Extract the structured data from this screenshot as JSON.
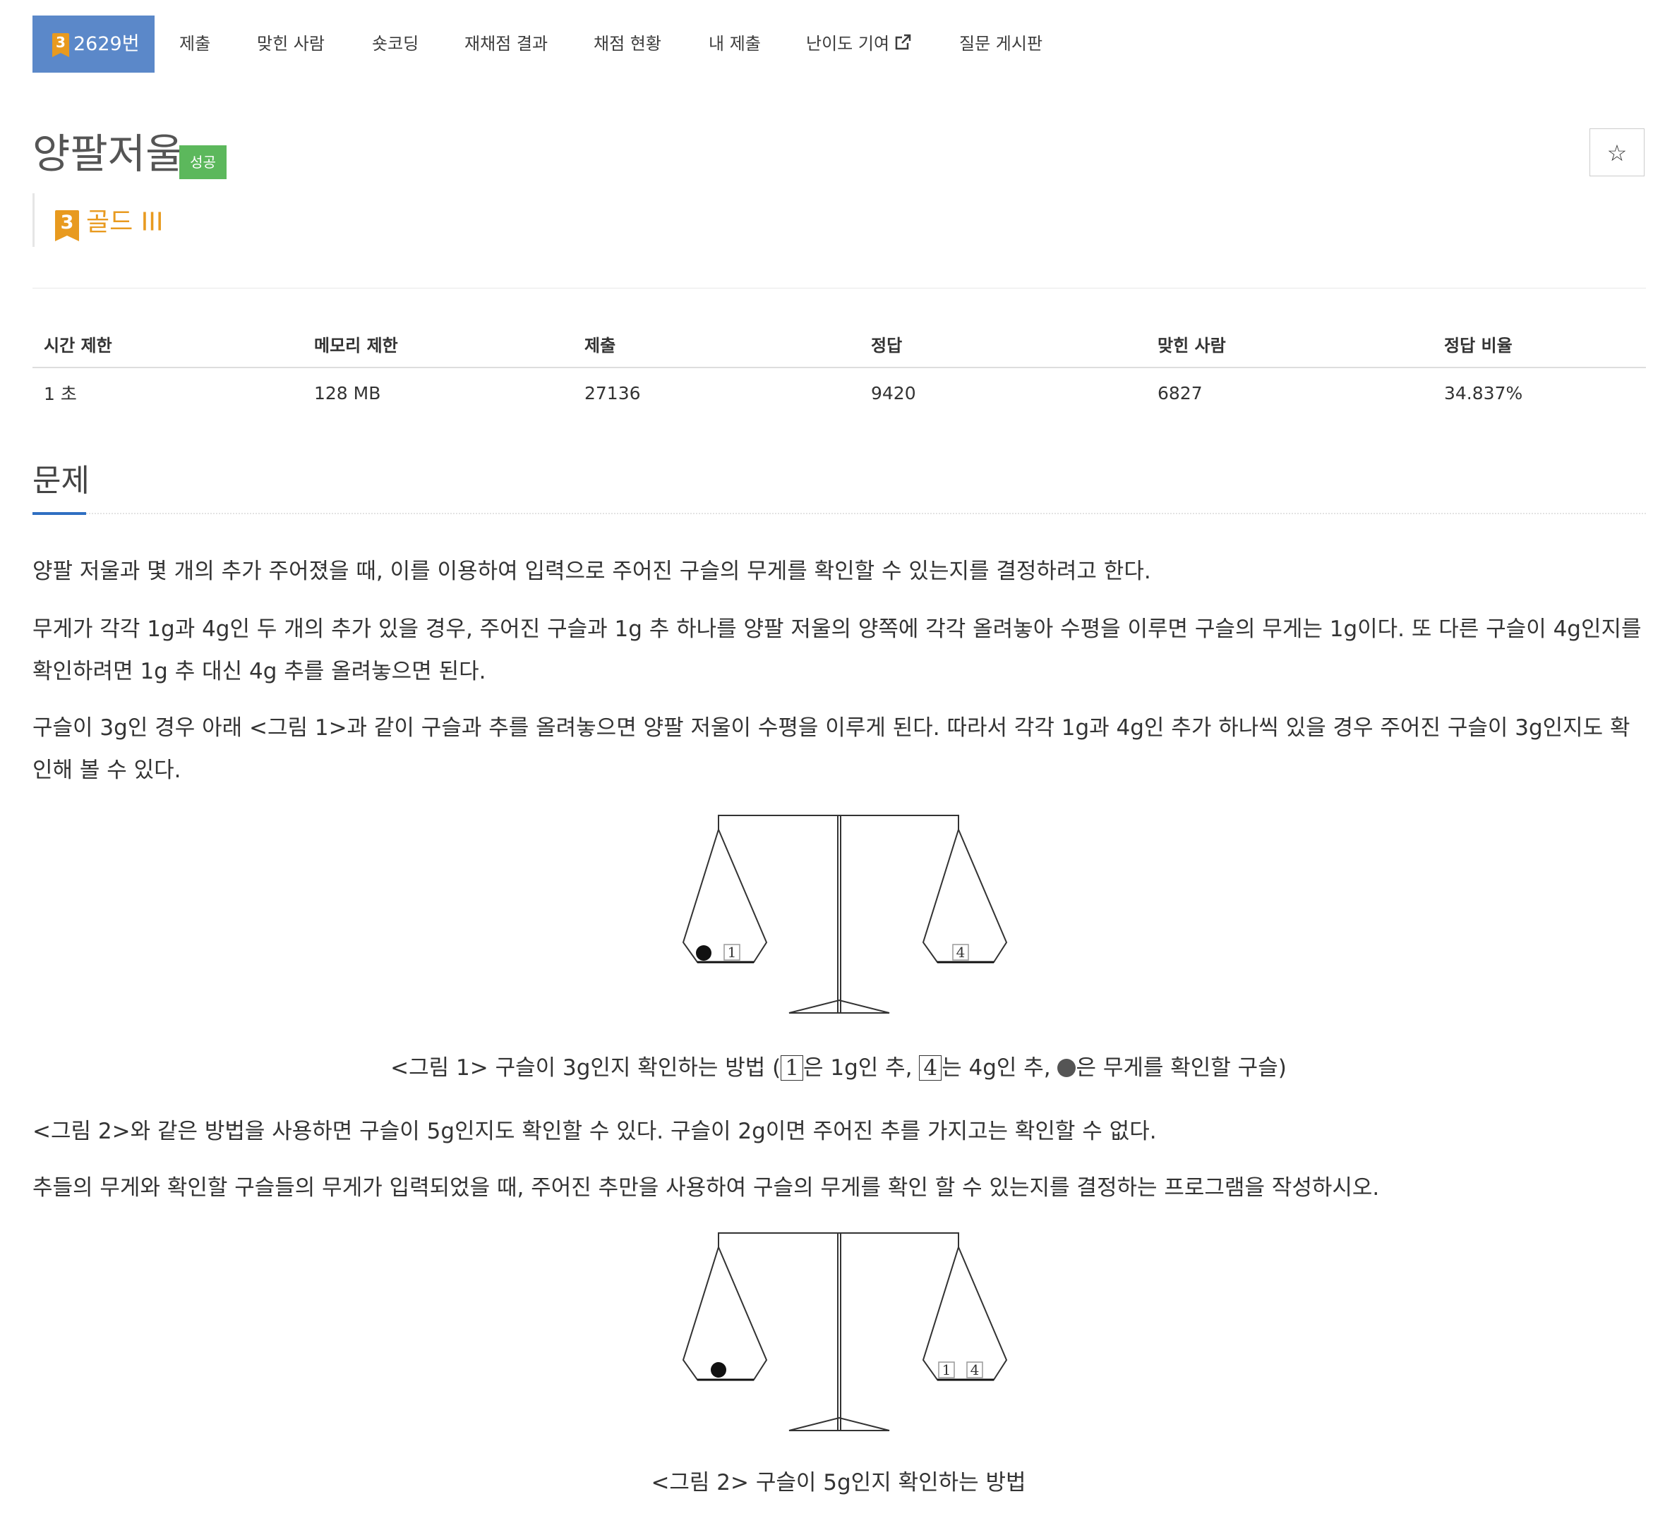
{
  "nav": {
    "tabs": [
      {
        "label": "2629번",
        "tier": "3"
      },
      {
        "label": "제출"
      },
      {
        "label": "맞힌 사람"
      },
      {
        "label": "숏코딩"
      },
      {
        "label": "재채점 결과"
      },
      {
        "label": "채점 현황"
      },
      {
        "label": "내 제출"
      },
      {
        "label": "난이도 기여"
      },
      {
        "label": "질문 게시판"
      }
    ]
  },
  "problem": {
    "title": "양팔저울",
    "status_badge": "성공",
    "star": "☆",
    "tier_number": "3",
    "tier_label": "골드 III"
  },
  "info_table": {
    "headers": [
      "시간 제한",
      "메모리 제한",
      "제출",
      "정답",
      "맞힌 사람",
      "정답 비율"
    ],
    "values": [
      "1 초",
      "128 MB",
      "27136",
      "9420",
      "6827",
      "34.837%"
    ]
  },
  "section": {
    "title": "문제",
    "p1": "양팔 저울과 몇 개의 추가 주어졌을 때, 이를 이용하여 입력으로 주어진 구슬의 무게를 확인할 수 있는지를 결정하려고 한다.",
    "p2": "무게가 각각 1g과 4g인 두 개의 추가 있을 경우, 주어진 구슬과 1g 추 하나를 양팔 저울의 양쪽에 각각 올려놓아 수평을 이루면 구슬의 무게는 1g이다. 또 다른 구슬이 4g인지를 확인하려면 1g 추 대신 4g 추를 올려놓으면 된다.",
    "p3": "구슬이 3g인 경우 아래 <그림 1>과 같이 구슬과 추를 올려놓으면 양팔 저울이 수평을 이루게 된다. 따라서 각각 1g과 4g인 추가 하나씩 있을 경우 주어진 구슬이 3g인지도 확인해 볼 수 있다.",
    "fig1_caption": {
      "a": "<그림 1> 구슬이 3g인지 확인하는 방법 (",
      "w1": "1",
      "b": "은 1g인 추, ",
      "w4": "4",
      "c": "는 4g인 추, ",
      "d": "은 무게를 확인할 구슬)"
    },
    "p4": "<그림 2>와 같은 방법을 사용하면 구슬이 5g인지도 확인할 수 있다. 구슬이 2g이면 주어진 추를 가지고는 확인할 수 없다.",
    "p5": "추들의 무게와 확인할 구슬들의 무게가 입력되었을 때, 주어진 추만을 사용하여 구슬의 무게를 확인 할 수 있는지를 결정하는 프로그램을 작성하시오.",
    "fig2_caption": "<그림 2> 구슬이 5g인지 확인하는 방법"
  },
  "figures": {
    "fig1": {
      "left_pan": [
        "ball",
        "1"
      ],
      "right_pan": [
        "4"
      ]
    },
    "fig2": {
      "left_pan": [
        "ball"
      ],
      "right_pan": [
        "1",
        "4"
      ]
    }
  },
  "colors": {
    "active_tab": "#5b88c9",
    "success": "#5cb85c",
    "gold": "#e89a1f",
    "heading_underline": "#2f6fc2"
  }
}
